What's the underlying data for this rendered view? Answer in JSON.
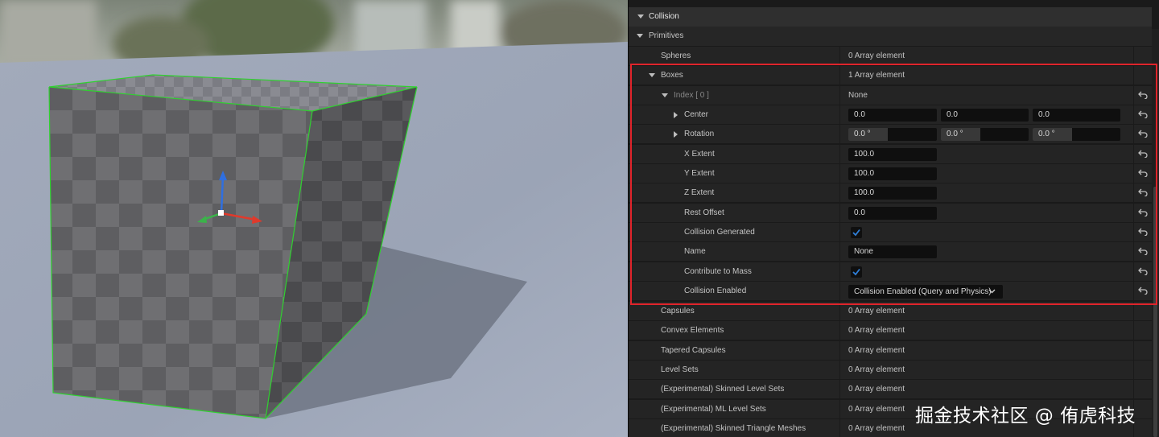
{
  "sections": {
    "collision": "Collision",
    "primitives": "Primitives"
  },
  "rows": {
    "spheres": {
      "label": "Spheres",
      "value": "0 Array element"
    },
    "boxes": {
      "label": "Boxes",
      "value": "1 Array element"
    },
    "index": {
      "label": "Index [ 0 ]",
      "value": "None"
    },
    "center": {
      "label": "Center",
      "x": "0.0",
      "y": "0.0",
      "z": "0.0"
    },
    "rotation": {
      "label": "Rotation",
      "x": "0.0 °",
      "y": "0.0 °",
      "z": "0.0 °"
    },
    "x_extent": {
      "label": "X Extent",
      "value": "100.0"
    },
    "y_extent": {
      "label": "Y Extent",
      "value": "100.0"
    },
    "z_extent": {
      "label": "Z Extent",
      "value": "100.0"
    },
    "rest_offset": {
      "label": "Rest Offset",
      "value": "0.0"
    },
    "collision_generated": {
      "label": "Collision Generated",
      "checked": true
    },
    "name": {
      "label": "Name",
      "value": "None"
    },
    "contribute_to_mass": {
      "label": "Contribute to Mass",
      "checked": true
    },
    "collision_enabled": {
      "label": "Collision Enabled",
      "value": "Collision Enabled (Query and Physics)"
    },
    "capsules": {
      "label": "Capsules",
      "value": "0 Array element"
    },
    "convex": {
      "label": "Convex Elements",
      "value": "0 Array element"
    },
    "tapered": {
      "label": "Tapered Capsules",
      "value": "0 Array element"
    },
    "level_sets": {
      "label": "Level Sets",
      "value": "0 Array element"
    },
    "skinned_level_sets": {
      "label": "(Experimental) Skinned Level Sets",
      "value": "0 Array element"
    },
    "ml_level_sets": {
      "label": "(Experimental) ML Level Sets",
      "value": "0 Array element"
    },
    "skinned_tri_meshes": {
      "label": "(Experimental) Skinned Triangle Meshes",
      "value": "0 Array element"
    }
  },
  "watermark": "掘金技术社区 @ 侑虎科技",
  "colors": {
    "highlight_box": "#e0242b",
    "checkmark": "#2f7fd8",
    "selection_outline": "#2fd12f",
    "gizmo_x": "#e03a2c",
    "gizmo_y": "#3bb34a",
    "gizmo_z": "#2f6fe0"
  }
}
